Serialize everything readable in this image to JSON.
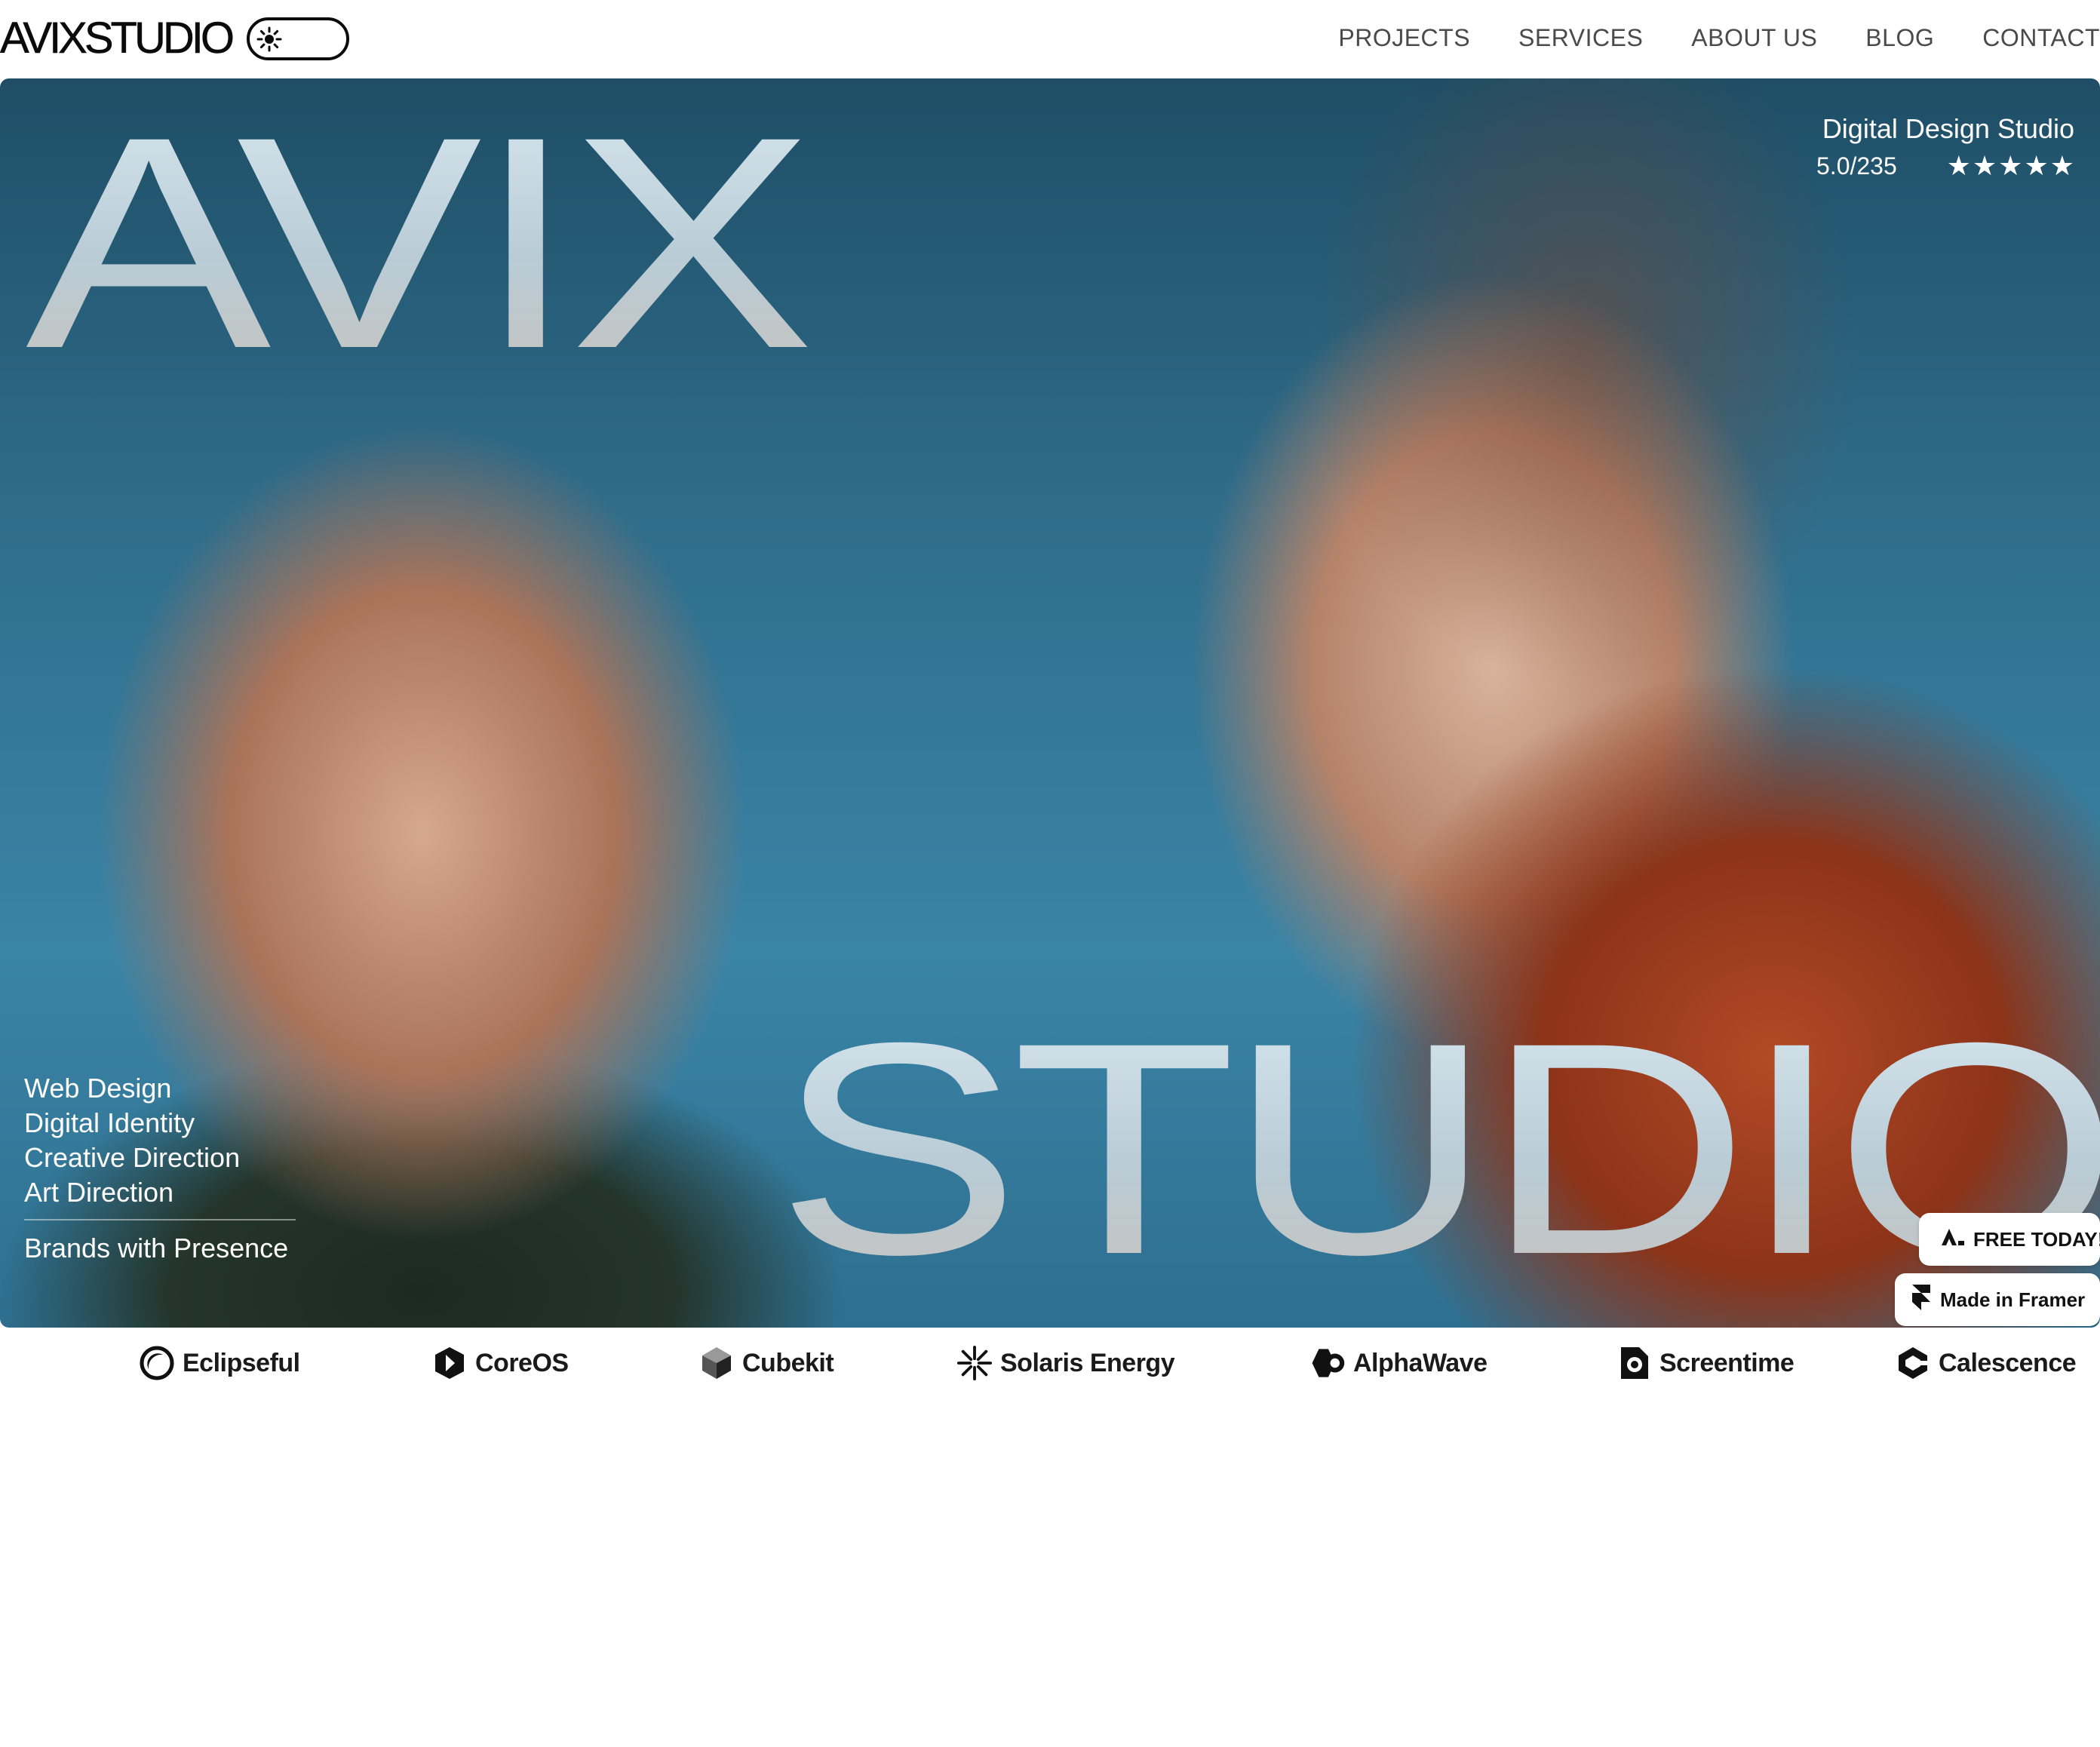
{
  "header": {
    "logo": "AVIXSTUDIO",
    "nav": [
      "PROJECTS",
      "SERVICES",
      "ABOUT US",
      "BLOG",
      "CONTACT"
    ]
  },
  "hero": {
    "title_top": "AVIX",
    "title_bottom": "STUDIO",
    "tagline": "Digital Design Studio",
    "rating": "5.0/235",
    "stars": 5,
    "services": [
      "Web Design",
      "Digital Identity",
      "Creative Direction",
      "Art Direction"
    ],
    "statement": "Brands with Presence"
  },
  "badges": {
    "free": "FREE TODAY!",
    "framer": "Made in Framer"
  },
  "brands": [
    {
      "name": "Eclipseful",
      "icon": "eclipse-icon"
    },
    {
      "name": "CoreOS",
      "icon": "hexagon-icon"
    },
    {
      "name": "Cubekit",
      "icon": "cube-icon"
    },
    {
      "name": "Solaris Energy",
      "icon": "sunburst-icon"
    },
    {
      "name": "AlphaWave",
      "icon": "alphawave-icon"
    },
    {
      "name": "Screentime",
      "icon": "screentime-icon"
    },
    {
      "name": "Calescence",
      "icon": "calescence-icon"
    }
  ]
}
